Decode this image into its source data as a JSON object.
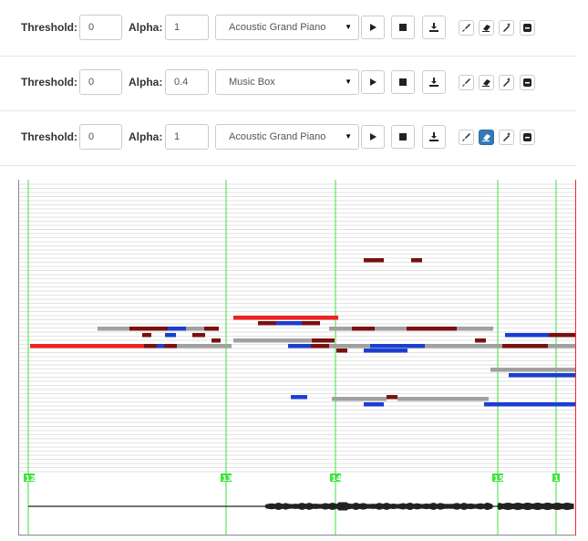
{
  "tracks": [
    {
      "threshold_label": "Threshold:",
      "threshold_value": "0",
      "alpha_label": "Alpha:",
      "alpha_value": "1",
      "instrument": "Acoustic Grand Piano",
      "active_tool": ""
    },
    {
      "threshold_label": "Threshold:",
      "threshold_value": "0",
      "alpha_label": "Alpha:",
      "alpha_value": "0.4",
      "instrument": "Music Box",
      "active_tool": ""
    },
    {
      "threshold_label": "Threshold:",
      "threshold_value": "0",
      "alpha_label": "Alpha:",
      "alpha_value": "1",
      "instrument": "Acoustic Grand Piano",
      "active_tool": "eraser"
    }
  ],
  "icons": {
    "play": "play-icon",
    "stop": "stop-icon",
    "download": "download-icon",
    "brush": "brush-icon",
    "eraser": "eraser-icon",
    "wand": "magic-wand-icon",
    "minus": "minus-icon"
  },
  "timeline": {
    "measure_markers": [
      "12",
      "13",
      "14",
      "15",
      "1"
    ]
  },
  "colors": {
    "beat_line": "#39e639",
    "playhead": "#ff2222",
    "note_red": "#ee2222",
    "note_gray": "#a0a0a0",
    "note_dark": "#7a1010",
    "note_blue": "#1a3fd0"
  }
}
